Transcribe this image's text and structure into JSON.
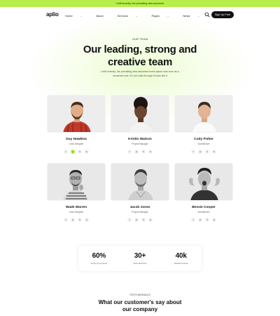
{
  "announcement": "Until recently, the prevailing view assumed",
  "nav": {
    "logo": "aplio",
    "items": [
      {
        "label": "Home",
        "caret": true
      },
      {
        "label": "About",
        "caret": false
      },
      {
        "label": "Services",
        "caret": true
      },
      {
        "label": "Pages",
        "caret": true
      },
      {
        "label": "News",
        "caret": true
      },
      {
        "label": "Contact Us",
        "caret": false
      }
    ],
    "caret_glyph": "⌄",
    "signup_label": "Sign Up Free"
  },
  "team": {
    "eyebrow": "OUR TEAM",
    "headline_line1": "Our leading, strong and",
    "headline_line2": "creative team",
    "description": "Until recently, the prevailing view assumed lorem ipsum was born as a nonsense text. It's not Latin through it looks like it",
    "members": [
      {
        "name": "Guy Hawkins",
        "role": "Lead Designer"
      },
      {
        "name": "Kristin Watson",
        "role": "Project Manager"
      },
      {
        "name": "Cody Fisher",
        "role": "Architecture"
      },
      {
        "name": "Wade Warren",
        "role": "Lead Designer"
      },
      {
        "name": "Jacob Jones",
        "role": "Project Manager"
      },
      {
        "name": "Bessie Cooper",
        "role": "Architecture"
      }
    ],
    "social_glyphs": [
      "f",
      "◎",
      "𝕏",
      "in"
    ]
  },
  "stats": [
    {
      "value": "60%",
      "label": "Project Completed"
    },
    {
      "value": "30+",
      "label": "Team Members"
    },
    {
      "value": "40k",
      "label": "Satisfied Clients"
    }
  ],
  "testimonials": {
    "eyebrow": "TESTIMONIALS",
    "title_line1": "What our customer's say about",
    "title_line2": "our company"
  },
  "colors": {
    "accent": "#b6ef4a",
    "dark": "#111111"
  }
}
